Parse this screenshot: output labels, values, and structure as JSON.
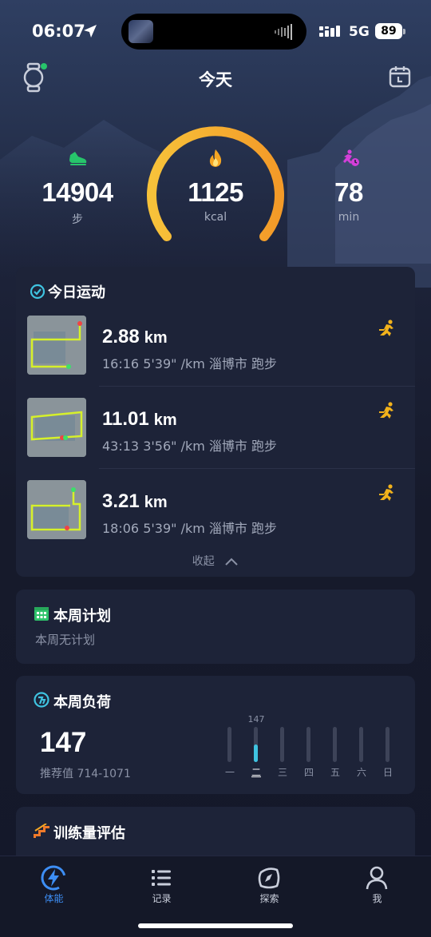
{
  "status": {
    "time": "06:07",
    "network": "5G",
    "battery": "89"
  },
  "header": {
    "title": "今天"
  },
  "stats": {
    "steps": {
      "value": "14904",
      "unit": "步"
    },
    "calories": {
      "value": "1125",
      "unit": "kcal"
    },
    "minutes": {
      "value": "78",
      "unit": "min"
    }
  },
  "today": {
    "title": "今日运动",
    "activities": [
      {
        "distance": "2.88",
        "unit": "km",
        "meta": "16:16  5'39\" /km 淄博市 跑步"
      },
      {
        "distance": "11.01",
        "unit": "km",
        "meta": "43:13  3'56\" /km 淄博市 跑步"
      },
      {
        "distance": "3.21",
        "unit": "km",
        "meta": "18:06  5'39\" /km 淄博市 跑步"
      }
    ],
    "collapse": "收起"
  },
  "plan": {
    "title": "本周计划",
    "empty": "本周无计划"
  },
  "load": {
    "title": "本周负荷",
    "value": "147",
    "recommend": "推荐值 714-1071",
    "days": [
      "一",
      "二",
      "三",
      "四",
      "五",
      "六",
      "日"
    ],
    "values": [
      0,
      147,
      0,
      0,
      0,
      0,
      0
    ],
    "active_day_label": "147"
  },
  "volume": {
    "title": "训练量评估"
  },
  "tabs": [
    {
      "label": "体能",
      "active": true
    },
    {
      "label": "记录",
      "active": false
    },
    {
      "label": "探索",
      "active": false
    },
    {
      "label": "我",
      "active": false
    }
  ],
  "colors": {
    "accent": "#3d8ef5",
    "gauge_start": "#f7c23a",
    "gauge_end": "#f39a28",
    "run": "#f2b21b",
    "steps_green": "#27c46b",
    "time_pink": "#d43fd9",
    "route": "#d6f02a",
    "load_bar": "#3fc3e0"
  }
}
